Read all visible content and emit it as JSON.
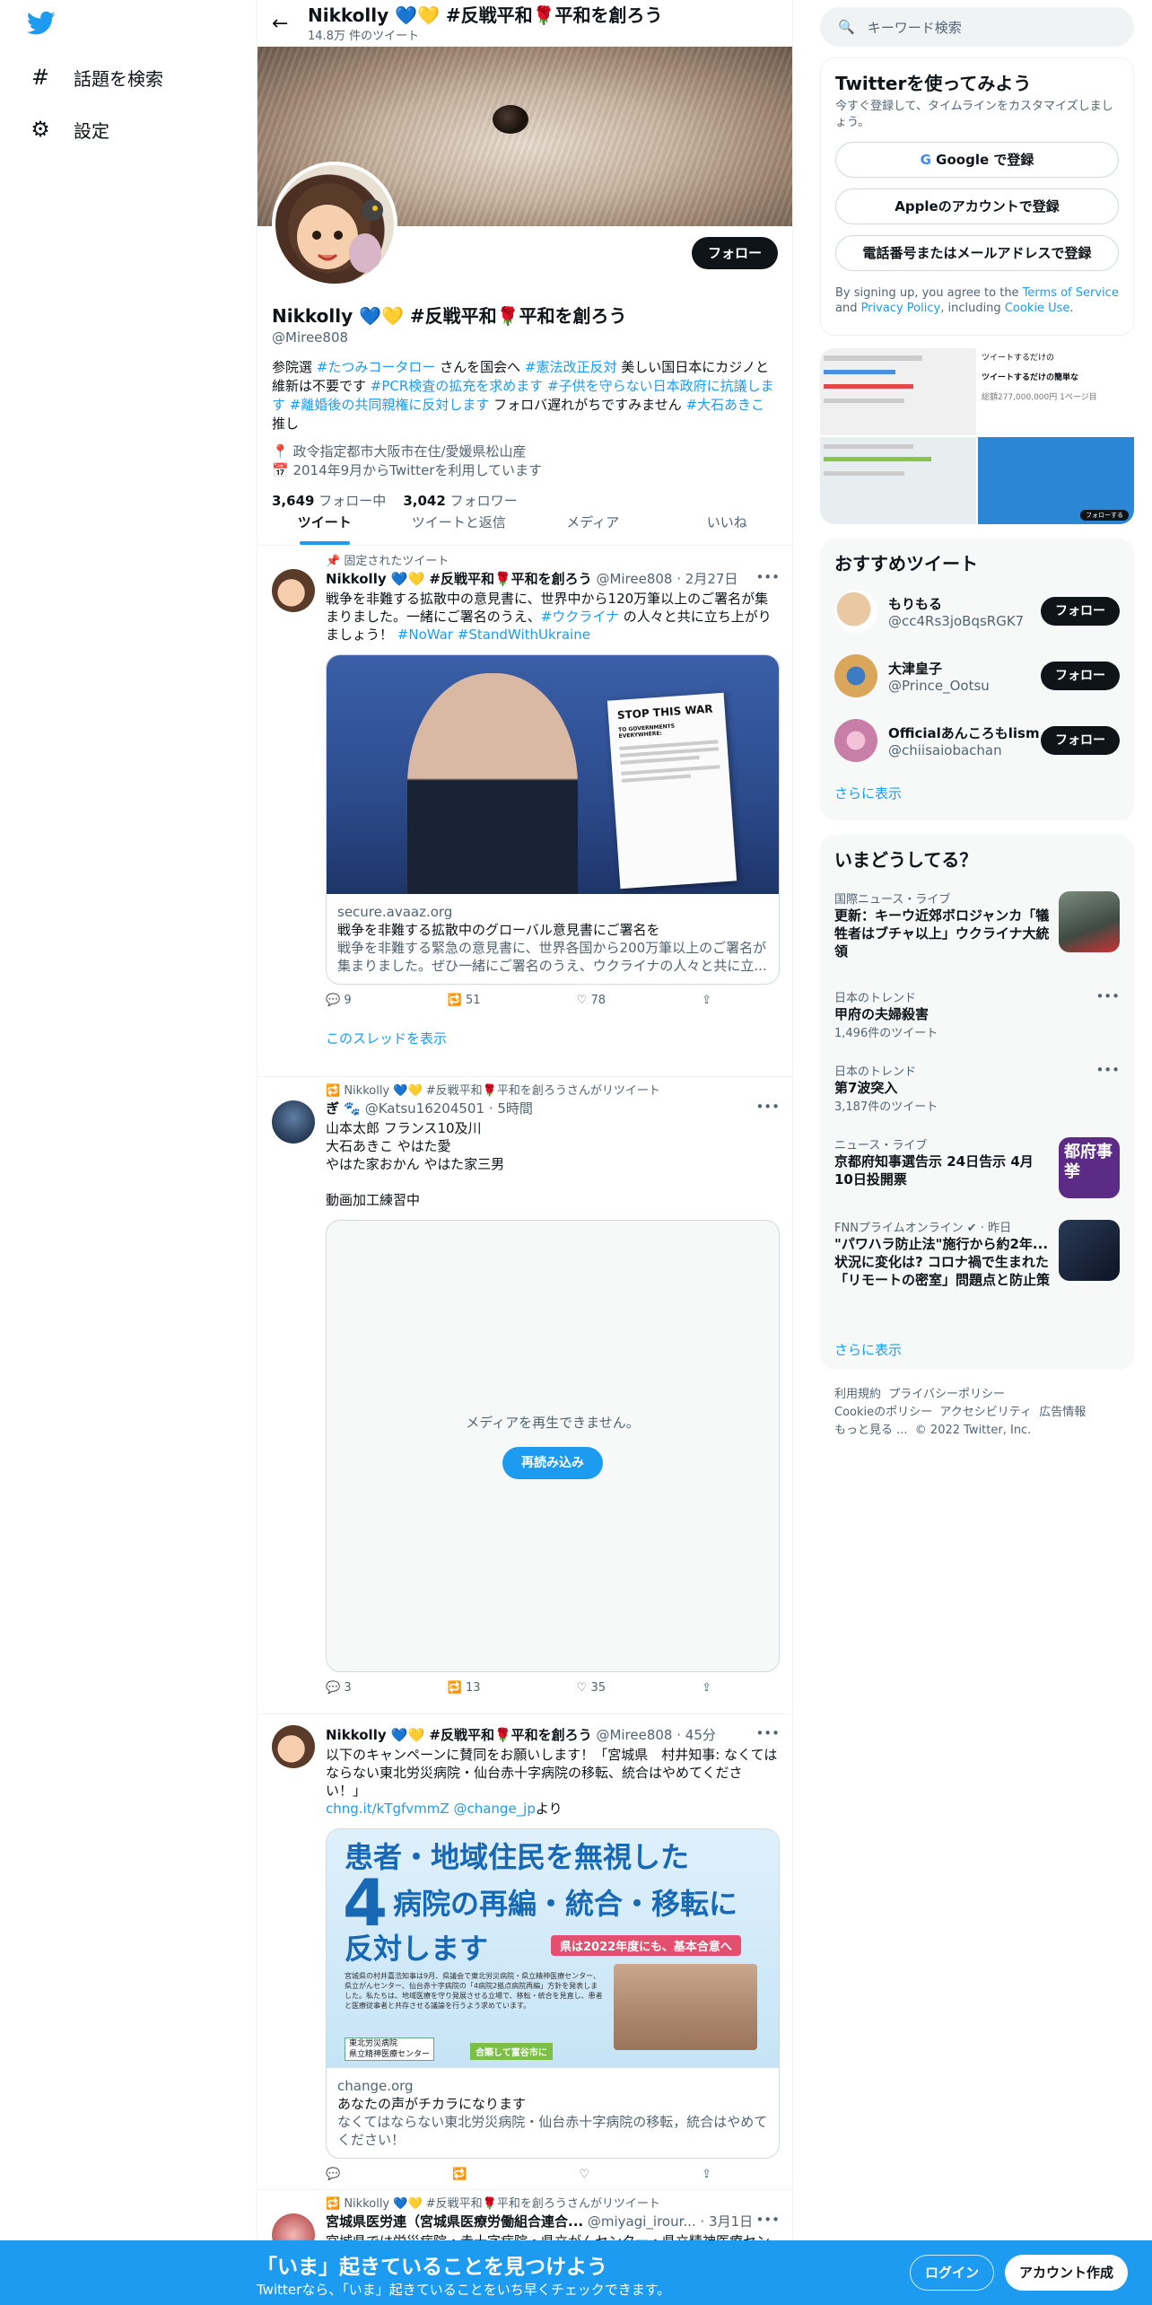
{
  "leftnav": {
    "items": [
      {
        "label": "話題を検索",
        "icon": "hashtag-icon"
      },
      {
        "label": "設定",
        "icon": "gear-icon"
      }
    ]
  },
  "header": {
    "name": "Nikkolly 💙💛 #反戦平和🌹平和を創ろう",
    "tweet_count": "14.8万 件のツイート"
  },
  "profile": {
    "follow_label": "フォロー",
    "name": "Nikkolly 💙💛 #反戦平和🌹平和を創ろう",
    "handle": "@Miree808",
    "bio_parts": {
      "p1": "参院選 ",
      "h1": "#たつみコータロー",
      "p2": " さんを国会へ ",
      "h2": "#憲法改正反対",
      "p3": " 美しい国日本にカジノと維新は不要です ",
      "h3": "#PCR検査の拡充を求めます",
      "p4": " ",
      "h4": "#子供を守らない日本政府に抗議します",
      "p5": " ",
      "h5": "#離婚後の共同親権に反対します",
      "p6": " フォロバ遅れがちですみません ",
      "h6": "#大石あきこ",
      "p7": " 推し"
    },
    "location": "政令指定都市大阪市在住/愛媛県松山産",
    "joined": "2014年9月からTwitterを利用しています",
    "following_count": "3,649",
    "following_label": "フォロー中",
    "followers_count": "3,042",
    "followers_label": "フォロワー"
  },
  "tabs": [
    "ツイート",
    "ツイートと返信",
    "メディア",
    "いいね"
  ],
  "tweets": {
    "t1": {
      "context": "固定されたツイート",
      "name": "Nikkolly 💙💛 #反戦平和🌹平和を創ろう",
      "handle": "@Miree808",
      "time": "· 2月27日",
      "text_a": "戦争を非難する拡散中の意見書に、世界中から120万筆以上のご署名が集まりました。一緒にご署名のうえ、",
      "text_h1": "#ウクライナ",
      "text_b": " の人々と共に立ち上がりましょう！ ",
      "text_h2": "#NoWar",
      "text_h3": "#StandWithUkraine",
      "sign_title": "STOP THIS WAR",
      "sign_sub": "TO GOVERNMENTS EVERYWHERE:",
      "card_domain": "secure.avaaz.org",
      "card_title": "戦争を非難する拡散中のグローバル意見書にご署名を",
      "card_desc": "戦争を非難する緊急の意見書に、世界各国から200万筆以上のご署名が集まりました。ぜひ一緒にご署名のうえ、ウクライナの人々と共に立...",
      "replies": "9",
      "retweets": "51",
      "likes": "78",
      "thread_link": "このスレッドを表示"
    },
    "t2": {
      "context": "Nikkolly 💙💛 #反戦平和🌹平和を創ろうさんがリツイート",
      "name": "ぎ 🐾",
      "handle": "@Katsu16204501",
      "time": "· 5時間",
      "line1": "山本太郎 フランス10及川",
      "line2": "大石あきこ やはた愛",
      "line3": "やはた家おかん やはた家三男",
      "line4": "動画加工練習中",
      "media_error": "メディアを再生できません。",
      "reload_label": "再読み込み",
      "replies": "3",
      "retweets": "13",
      "likes": "35"
    },
    "t3": {
      "name": "Nikkolly 💙💛 #反戦平和🌹平和を創ろう",
      "handle": "@Miree808",
      "time": "· 45分",
      "text": "以下のキャンペーンに賛同をお願いします！「宮城県　村井知事: なくてはならない東北労災病院・仙台赤十字病院の移転、統合はやめてください！」",
      "link": "chng.it/kTgfvmmZ",
      "mention": "@change_jp",
      "suffix": "より",
      "banner_line1": "患者・地域住民を無視した",
      "banner_big": "4",
      "banner_line2": "病院の再編・統合・移転に",
      "banner_line3": "反対します",
      "banner_tag": "県は2022年度にも、基本合意へ",
      "banner_small": "宮城県の村井嘉浩知事は9月、県議会で東北労災病院・県立精神医療センター、県立がんセンター、仙台赤十字病院の「4病院2拠点病院再編」方針を発表しました。私たちは、地域医療を守り発展させる立場で、移転・統合を見直し、患者と医療従事者と共存させる議論を行うよう求めています。",
      "banner_label1": "東北労災病院",
      "banner_label2": "県立精神医療センター",
      "banner_green": "合築して富谷市に",
      "card_domain": "change.org",
      "card_title": "あなたの声がチカラになります",
      "card_desc": "なくてはならない東北労災病院・仙台赤十字病院の移転，統合はやめてください！"
    },
    "t4": {
      "context": "Nikkolly 💙💛 #反戦平和🌹平和を創ろうさんがリツイート",
      "name": "宮城県医労連（宮城県医療労働組合連合...",
      "handle": "@miyagi_irour...",
      "time": "· 3月1日",
      "text": "宮城県では労災病院・赤十字病院・県立がんセンター・県立精神医療センター"
    }
  },
  "right": {
    "search_placeholder": "キーワード検索",
    "signup": {
      "title": "Twitterを使ってみよう",
      "subtitle": "今すぐ登録して、タイムラインをカスタマイズしましょう。",
      "google": "Google で登録",
      "apple": "Appleのアカウントで登録",
      "phone": "電話番号またはメールアドレスで登録",
      "terms_a": "By signing up, you agree to the ",
      "terms_link1": "Terms of Service",
      "terms_b": " and ",
      "terms_link2": "Privacy Policy",
      "terms_c": ", including ",
      "terms_link3": "Cookie Use",
      "terms_d": "."
    },
    "media_grid_texts": {
      "a": "ツイートするだけの",
      "b": "ツイートするだけの簡単な",
      "c": "総額277,000,000円 1ページ目",
      "d": "フォローする"
    },
    "recommend": {
      "title": "おすすめツイート",
      "users": [
        {
          "name": "もりもる",
          "handle": "@cc4Rs3joBqsRGK7",
          "btn": "フォロー",
          "color": "#e8c9a2"
        },
        {
          "name": "大津皇子",
          "handle": "@Prince_Ootsu",
          "btn": "フォロー",
          "color": "#d9a65a"
        },
        {
          "name": "Officialあんころもlism",
          "handle": "@chiisaiobachan",
          "btn": "フォロー",
          "color": "#c77fa8"
        }
      ],
      "more": "さらに表示"
    },
    "trends": {
      "title": "いまどうしてる？",
      "items": [
        {
          "meta": "国際ニュース・ライブ",
          "title": "更新：キーウ近郊ボロジャンカ「犠牲者はブチャ以上」ウクライナ大統領",
          "count": ""
        },
        {
          "meta": "日本のトレンド",
          "title": "甲府の夫婦殺害",
          "count": "1,496件のツイート"
        },
        {
          "meta": "日本のトレンド",
          "title": "第7波突入",
          "count": "3,187件のツイート"
        },
        {
          "meta": "ニュース・ライブ",
          "title": "京都府知事選告示 24日告示 4月10日投開票",
          "count": ""
        },
        {
          "meta": "FNNプライムオンライン ✔ · 昨日",
          "title": "\"パワハラ防止法\"施行から約2年...状況に変化は? コロナ禍で生まれた「リモートの密室」問題点と防止策",
          "count": ""
        }
      ],
      "thumb_text": "都府事挙",
      "more": "さらに表示"
    },
    "footer": {
      "l1": "利用規約",
      "l2": "プライバシーポリシー",
      "l3": "Cookieのポリシー",
      "l4": "アクセシビリティ",
      "l5": "広告情報",
      "l6": "もっと見る ...",
      "copy": "© 2022 Twitter, Inc."
    }
  },
  "bottombar": {
    "title": "「いま」起きていることを見つけよう",
    "subtitle": "Twitterなら、「いま」起きていることをいち早くチェックできます。",
    "login": "ログイン",
    "signup": "アカウント作成"
  },
  "colors": {
    "accent": "#1d9bf0",
    "text": "#0f1419",
    "muted": "#536471"
  }
}
